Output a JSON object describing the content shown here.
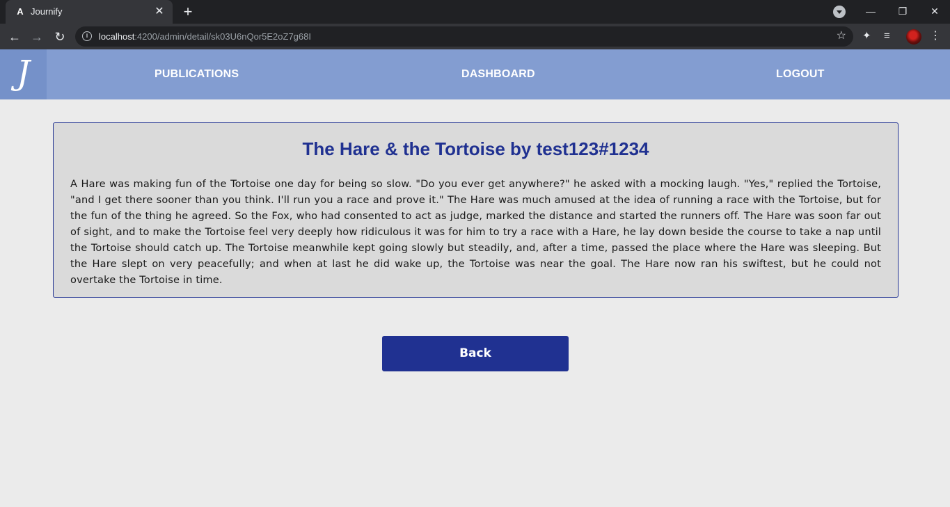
{
  "browser": {
    "tab_title": "Journify",
    "tab_favicon": "A",
    "url_host": "localhost",
    "url_path": ":4200/admin/detail/sk03U6nQor5E2oZ7g68I",
    "icons": [
      "angular-favicon",
      "close-icon",
      "plus-icon",
      "back-arrow-icon",
      "forward-arrow-icon",
      "reload-icon",
      "info-icon",
      "star-icon",
      "puzzle-icon",
      "media-queue-icon",
      "kebab-menu-icon",
      "minimize-icon",
      "restore-icon",
      "close-window-icon"
    ]
  },
  "header": {
    "logo_text": "J",
    "nav": {
      "publications": "PUBLICATIONS",
      "dashboard": "DASHBOARD",
      "logout": "LOGOUT"
    },
    "colors": {
      "bar": "#839dd1",
      "logo_bg": "#7591c9"
    }
  },
  "publication": {
    "title": "The Hare & the Tortoise by test123#1234",
    "body": "A Hare was making fun of the Tortoise one day for being so slow. \"Do you ever get anywhere?\" he asked with a mocking laugh. \"Yes,\" replied the Tortoise, \"and I get there sooner than you think. I'll run you a race and prove it.\" The Hare was much amused at the idea of running a race with the Tortoise, but for the fun of the thing he agreed. So the Fox, who had consented to act as judge, marked the distance and started the runners off. The Hare was soon far out of sight, and to make the Tortoise feel very deeply how ridiculous it was for him to try a race with a Hare, he lay down beside the course to take a nap until the Tortoise should catch up. The Tortoise meanwhile kept going slowly but steadily, and, after a time, passed the place where the Hare was sleeping. But the Hare slept on very peacefully; and when at last he did wake up, the Tortoise was near the goal. The Hare now ran his swiftest, but he could not overtake the Tortoise in time."
  },
  "actions": {
    "back_label": "Back",
    "accent": "#203191"
  }
}
